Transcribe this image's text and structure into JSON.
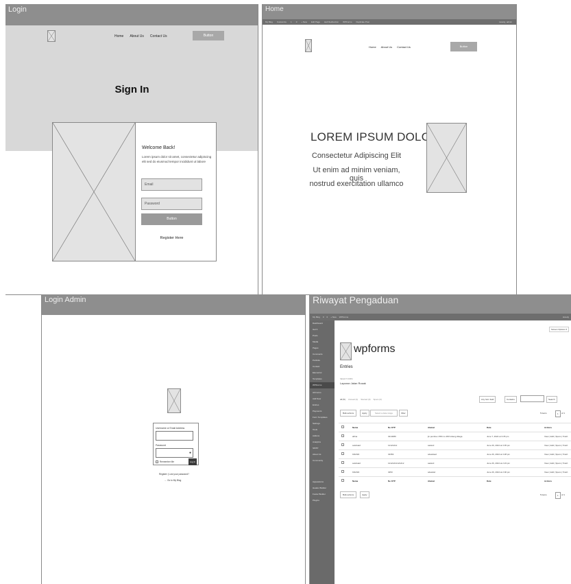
{
  "frames": {
    "login": {
      "title": "Login",
      "nav": [
        "Home",
        "About Us",
        "Contact Us"
      ],
      "nav_button": "Button",
      "heading": "Sign In",
      "welcome": "Welcome Back!",
      "lorem": "Lorem ipsum dolor sit amet, consectetur adipiscing elit sed do eiusmod tempor incididunt ut labore",
      "email_placeholder": "Email",
      "password_placeholder": "Password",
      "button": "Button",
      "register": "Register Here"
    },
    "home": {
      "title": "Home",
      "admin_bar": [
        "My Blog",
        "Customize",
        "1",
        "0",
        "+ New",
        "Edit Page",
        "Hell Redirection",
        "WPForms",
        "Duplicate Post"
      ],
      "howdy": "Howdy, admin",
      "nav": [
        "Home",
        "About Us",
        "Contact Us"
      ],
      "nav_button": "Button",
      "headline": "LOREM IPSUM DOLOR",
      "sub_lines": [
        "Consectetur Adipiscing Elit",
        "Ut enim ad minim veniam, quis",
        "nostrud exercitation ullamco"
      ]
    },
    "admin": {
      "title": "Login Admin",
      "username_label": "Username or Email Address",
      "password_label": "Password",
      "remember": "Remember Me",
      "login_button": "Log In",
      "links": [
        "Register | Lost your password?",
        "← Go to My Blog"
      ]
    },
    "riwayat": {
      "title": "Riwayat Pengaduan",
      "admin_bar": [
        "My Blog",
        "0",
        "0",
        "+ New",
        "WPForms"
      ],
      "howdy": "Howdy",
      "screen_options": "Screen Options ▾",
      "brand": "wpforms",
      "entries_title": "Entries",
      "select_form_label": "SELECT FORM",
      "form_name": "Laporan Jalan Rusak",
      "filters": [
        "All (5)",
        "Unread (3)",
        "Starred (0)",
        "Spam (0)"
      ],
      "bulk_actions": "Bulk actions",
      "apply": "Apply",
      "select_date": "Select a date range",
      "filter": "Filter",
      "any_form_field": "Any form field",
      "contains": "Contains",
      "search": "Search",
      "items_count": "5 items",
      "page_info": "of 1",
      "columns": [
        "Nama",
        "No KTP",
        "Alamat",
        "Date",
        "Actions"
      ],
      "rows": [
        {
          "name": "alfina",
          "ktp": "3214080",
          "alamat": "jln.pemba-n 584 no 483 lubang ditaga",
          "date": "June 7, 2024 at 3:35 pm",
          "actions": "View | Edit | Spam | Trash"
        },
        {
          "name": "sokdsaid",
          "ktp": "12121212",
          "alamat": "saskcd",
          "date": "June 26, 2024 at 3:35 pm",
          "actions": "View | Edit | Spam | Trash"
        },
        {
          "name": "KDASD",
          "ktp": "32353",
          "alamat": "sdasdsad",
          "date": "June 26, 2024 at 3:28 pm",
          "actions": "View | Edit | Spam | Trash"
        },
        {
          "name": "sokdsaid",
          "ktp": "12121212121212",
          "alamat": "saskcd",
          "date": "June 26, 2024 at 2:23 pm",
          "actions": "View | Edit | Spam | Trash"
        },
        {
          "name": "KDASD",
          "ktp": "3253",
          "alamat": "sdasdsd",
          "date": "June 26, 2024 at 2:00 pm",
          "actions": "View | Edit | Spam | Trash"
        }
      ],
      "sidebar": [
        "Dashboard",
        "Get It",
        "Posts",
        "Media",
        "Pages",
        "Comments",
        "Portfolio",
        "Contact",
        "Elementor",
        "Templates",
        "WPForms",
        "All Forms",
        "Add New",
        "Entries",
        "Payments",
        "Form Templates",
        "Settings",
        "Tools",
        "Addons",
        "Analytics",
        "SMTP",
        "About Us",
        "Community",
        "Appearance",
        "Header Builder",
        "Footer Builder",
        "Plugins"
      ]
    }
  }
}
